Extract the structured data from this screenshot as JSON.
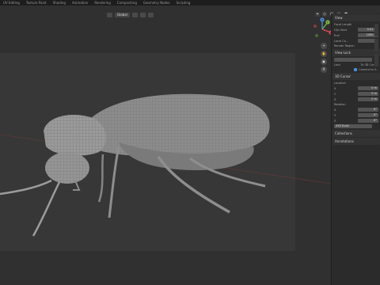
{
  "topbar": {
    "menus": [
      "UV Editing",
      "Texture Paint",
      "Shading",
      "Animation",
      "Rendering",
      "Compositing",
      "Geometry Nodes",
      "Scripting"
    ]
  },
  "header": {
    "mode_dropdown": "Global",
    "options_label": "Options"
  },
  "npanel": {
    "view_section": "View",
    "focal_length_label": "Focal Length",
    "clip_start_label": "Clip Start",
    "clip_start_value": "0.01 m",
    "clip_end_label": "End",
    "clip_end_value": "1000 m",
    "local_camera_label": "Local Ca...",
    "render_region_label": "Render Region",
    "view_lock_section": "View Lock",
    "lock_label": "Lock",
    "to_3d_cursor": "To 3D Cursor",
    "camera_to_view": "Camera to V...",
    "cursor_section": "3D Cursor",
    "location_label": "Location",
    "x_label": "X",
    "y_label": "Y",
    "z_label": "Z",
    "loc_x": "0 m",
    "loc_y": "0 m",
    "loc_z": "0 m",
    "rotation_label": "Rotation",
    "rot_x": "0°",
    "rot_y": "0°",
    "rot_z": "0°",
    "rotation_mode": "XYZ Euler",
    "collections_section": "Collections",
    "annotations_section": "Annotations"
  },
  "gizmo": {
    "x": "X",
    "y": "Y",
    "z": "Z"
  },
  "colors": {
    "x_axis": "#e04a5a",
    "y_axis": "#7bbf3a",
    "z_axis": "#4a8fe0",
    "accent": "#4a8fe0"
  }
}
